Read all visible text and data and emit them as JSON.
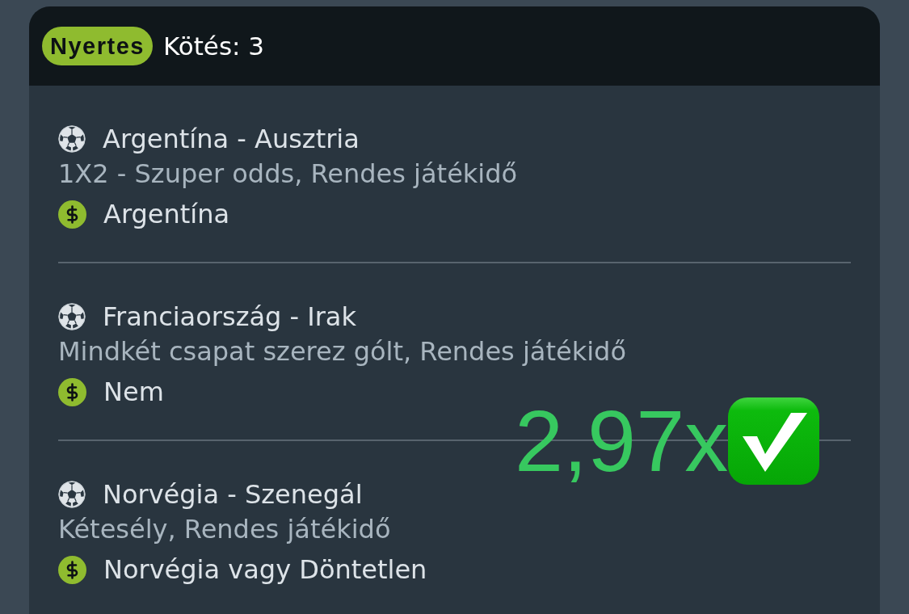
{
  "header": {
    "badge": "Nyertes",
    "title": "Kötés: 3"
  },
  "bets": [
    {
      "match": "Argentína - Ausztria",
      "market": "1X2 - Szuper odds, Rendes játékidő",
      "selection": "Argentína"
    },
    {
      "match": "Franciaország - Irak",
      "market": "Mindkét csapat szerez gólt, Rendes játékidő",
      "selection": "Nem"
    },
    {
      "match": "Norvégia - Szenegál",
      "market": "Kétesély, Rendes játékidő",
      "selection": "Norvégia vagy Döntetlen"
    }
  ],
  "overlay": {
    "odds": "2,97x"
  }
}
